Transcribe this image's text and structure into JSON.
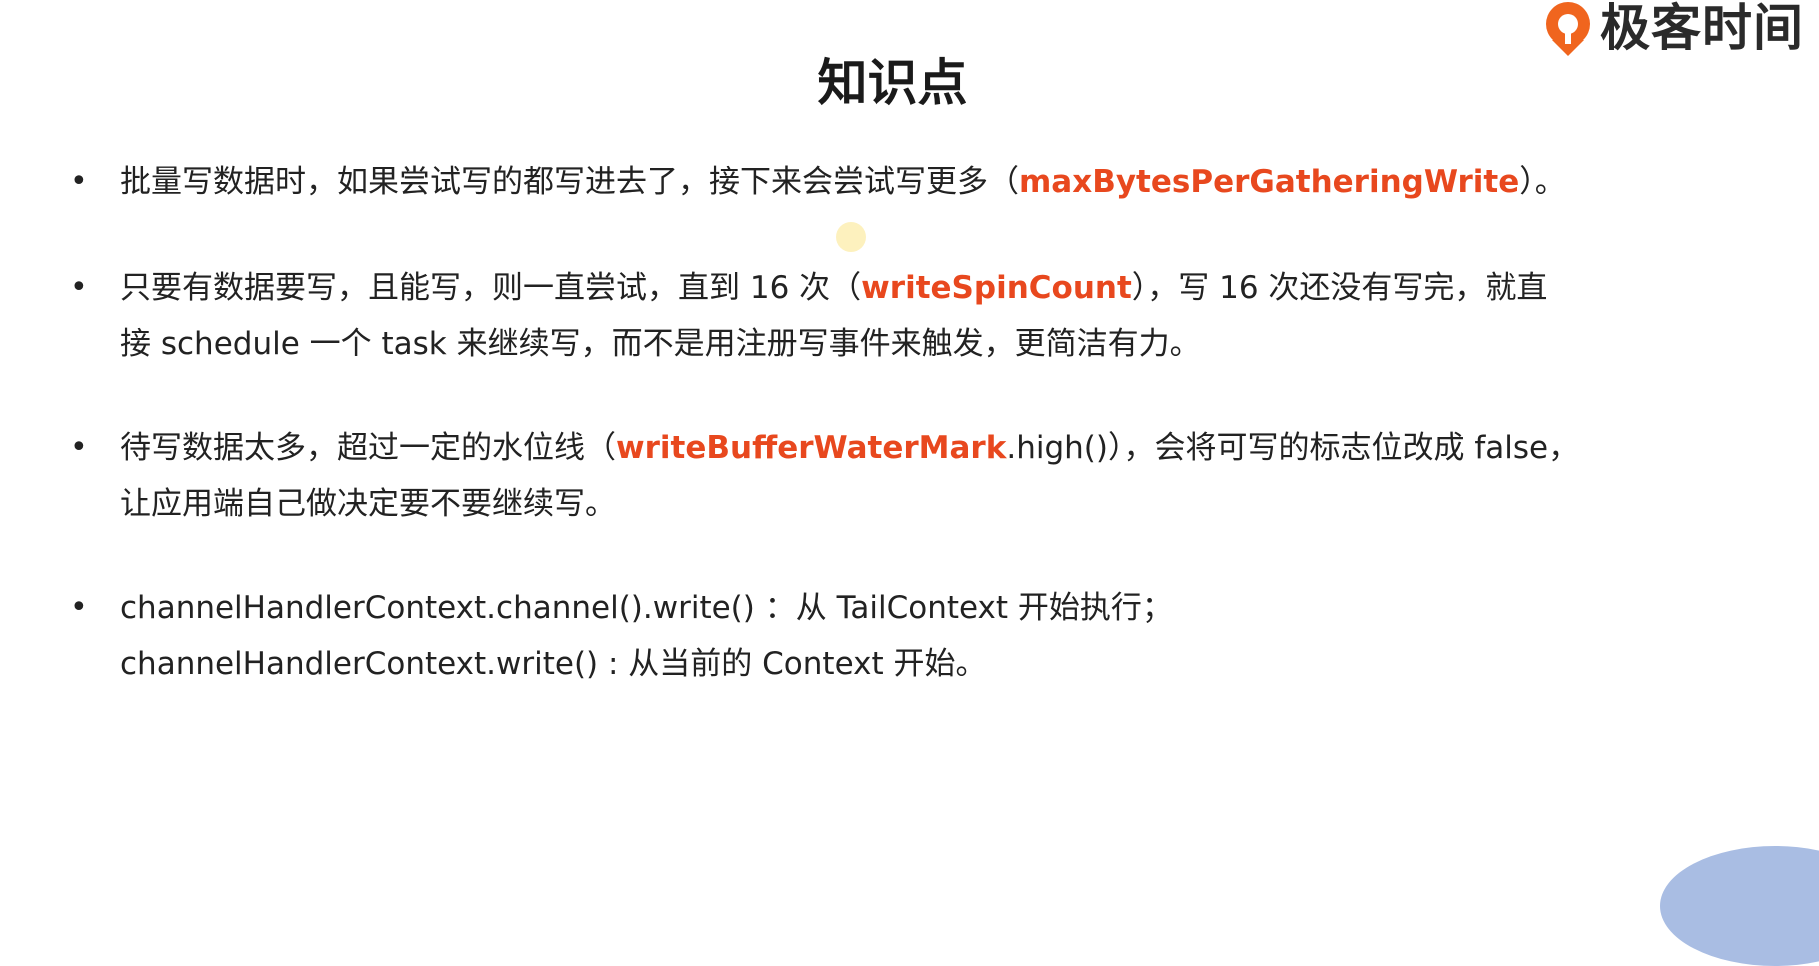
{
  "logo": {
    "text": "极客时间",
    "brand_color": "#f0651e"
  },
  "title": "知识点",
  "bullets": [
    {
      "lines": [
        {
          "a": "批量写数据时，如果尝试写的都写进去了，接下来会尝试写更多（",
          "hl": "maxBytesPerGatheringWrite",
          "b": "）。"
        }
      ]
    },
    {
      "lines": [
        {
          "a": "只要有数据要写，且能写，则一直尝试，直到 16 次（",
          "hl": "writeSpinCount",
          "b": "），写 16 次还没有写完，就直"
        },
        {
          "a": "接 schedule 一个 task 来继续写，而不是用注册写事件来触发，更简洁有力。"
        }
      ]
    },
    {
      "lines": [
        {
          "a": "待写数据太多，超过一定的水位线（",
          "hl": "writeBufferWaterMark",
          "b": ".high()），会将可写的标志位改成 false，"
        },
        {
          "a": "让应用端自己做决定要不要继续写。"
        }
      ]
    },
    {
      "lines": [
        {
          "a": "channelHandlerContext.channel().write() ：从 TailContext 开始执行；"
        },
        {
          "a": "channelHandlerContext.write() : 从当前的 Context 开始。"
        }
      ]
    }
  ],
  "highlight_color": "#e8481e"
}
